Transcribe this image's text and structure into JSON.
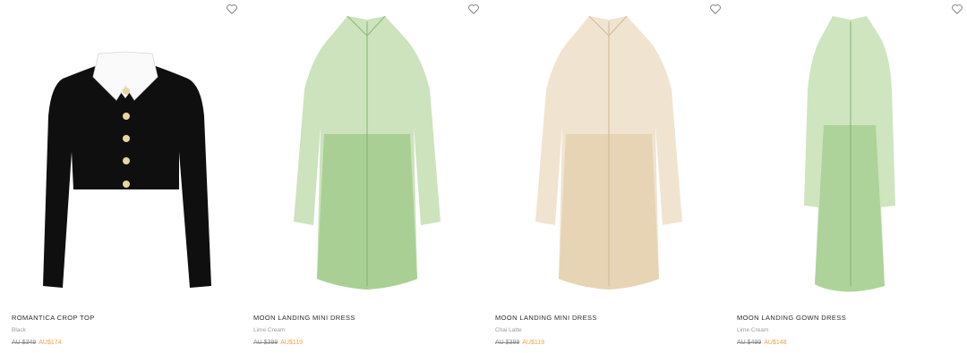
{
  "accent": {
    "sale": "#f0a04b"
  },
  "products": [
    {
      "name": "ROMANTICA CROP TOP",
      "colour": "Black",
      "was_price": "AU $349",
      "sale_price": "AU$174",
      "icon": "heart-outline-icon",
      "swatch": "#111111"
    },
    {
      "name": "MOON LANDING MINI DRESS",
      "colour": "Lime Cream",
      "was_price": "AU $399",
      "sale_price": "AU$119",
      "icon": "heart-outline-icon",
      "swatch": "#b9d8a8"
    },
    {
      "name": "MOON LANDING MINI DRESS",
      "colour": "Chai Latte",
      "was_price": "AU $399",
      "sale_price": "AU$119",
      "icon": "heart-outline-icon",
      "swatch": "#e9d9bf"
    },
    {
      "name": "MOON LANDING GOWN DRESS",
      "colour": "Lime Cream",
      "was_price": "AU $499",
      "sale_price": "AU$148",
      "icon": "heart-outline-icon",
      "swatch": "#bad9aa"
    }
  ]
}
